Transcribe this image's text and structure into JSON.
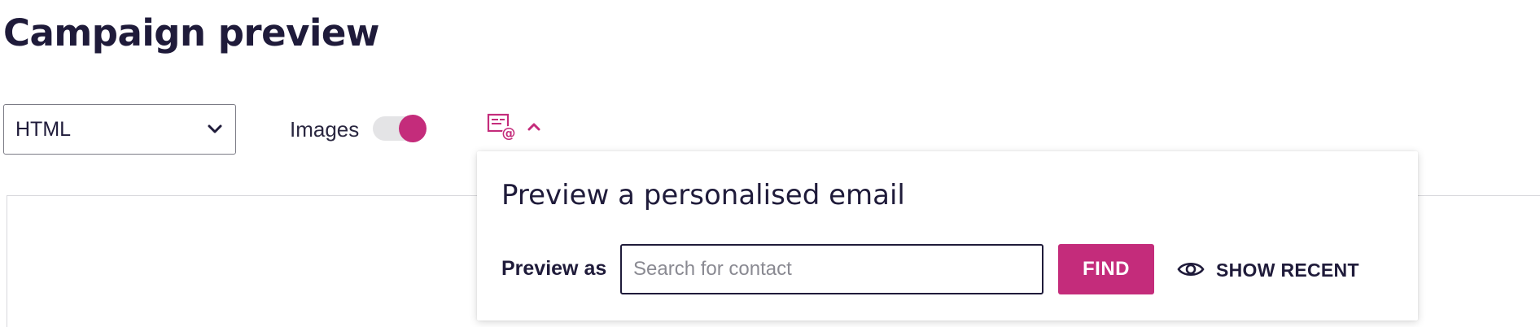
{
  "page": {
    "title": "Campaign preview"
  },
  "toolbar": {
    "format_select": {
      "selected": "HTML",
      "icon": "chevron-down-icon"
    },
    "images_toggle": {
      "label": "Images",
      "enabled": true
    },
    "personalise_trigger": {
      "icon": "personalised-email-icon",
      "state_icon": "chevron-up-icon"
    }
  },
  "popover": {
    "title": "Preview a personalised email",
    "preview_as_label": "Preview as",
    "search": {
      "placeholder": "Search for contact",
      "value": ""
    },
    "find_label": "FIND",
    "show_recent_label": "SHOW RECENT",
    "show_recent_icon": "eye-icon"
  },
  "colors": {
    "accent": "#c42c7b",
    "text": "#1f1b3a"
  }
}
